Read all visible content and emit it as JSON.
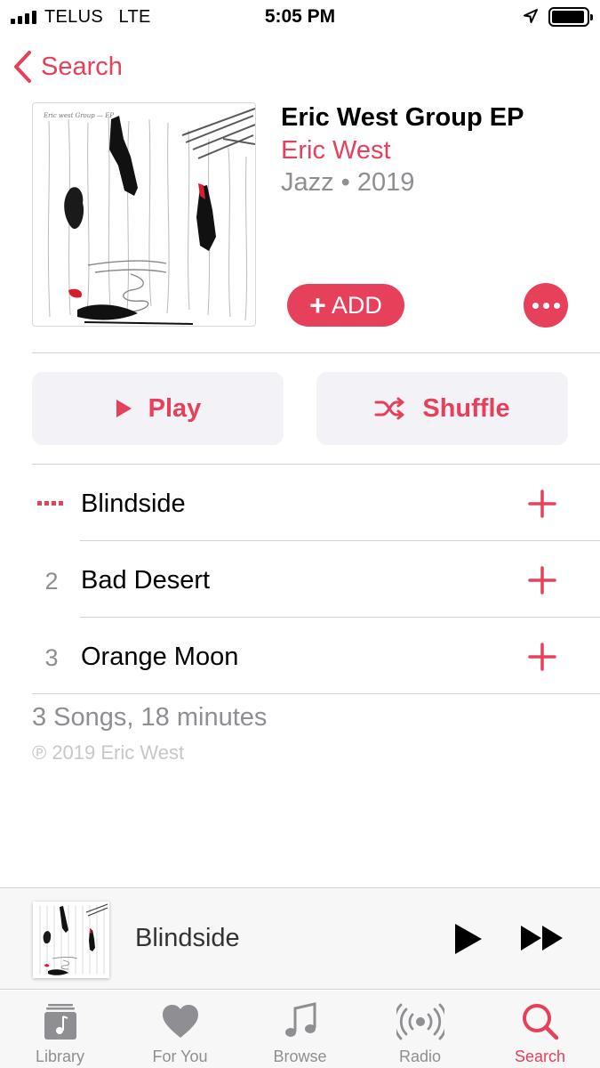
{
  "status_bar": {
    "carrier": "TELUS",
    "network": "LTE",
    "time": "5:05 PM"
  },
  "nav": {
    "back_label": "Search"
  },
  "album": {
    "title": "Eric West Group EP",
    "artist": "Eric West",
    "genre_year": "Jazz • 2019",
    "add_label": "ADD",
    "cover_lettering": "Eric west Group — EP"
  },
  "actions": {
    "play_label": "Play",
    "shuffle_label": "Shuffle"
  },
  "tracks": [
    {
      "number": "",
      "title": "Blindside",
      "now_playing": true
    },
    {
      "number": "2",
      "title": "Bad Desert",
      "now_playing": false
    },
    {
      "number": "3",
      "title": "Orange Moon",
      "now_playing": false
    }
  ],
  "summary": "3 Songs, 18 minutes",
  "copyright": "℗ 2019 Eric West",
  "mini_player": {
    "title": "Blindside"
  },
  "tab_bar": {
    "items": [
      {
        "label": "Library",
        "icon": "library-icon",
        "active": false
      },
      {
        "label": "For You",
        "icon": "heart-icon",
        "active": false
      },
      {
        "label": "Browse",
        "icon": "music-note-icon",
        "active": false
      },
      {
        "label": "Radio",
        "icon": "radio-icon",
        "active": false
      },
      {
        "label": "Search",
        "icon": "search-icon",
        "active": true
      }
    ]
  },
  "colors": {
    "accent": "#e6405a",
    "secondary_text": "#8e8e93",
    "pill_bg": "#f2f2f7"
  }
}
